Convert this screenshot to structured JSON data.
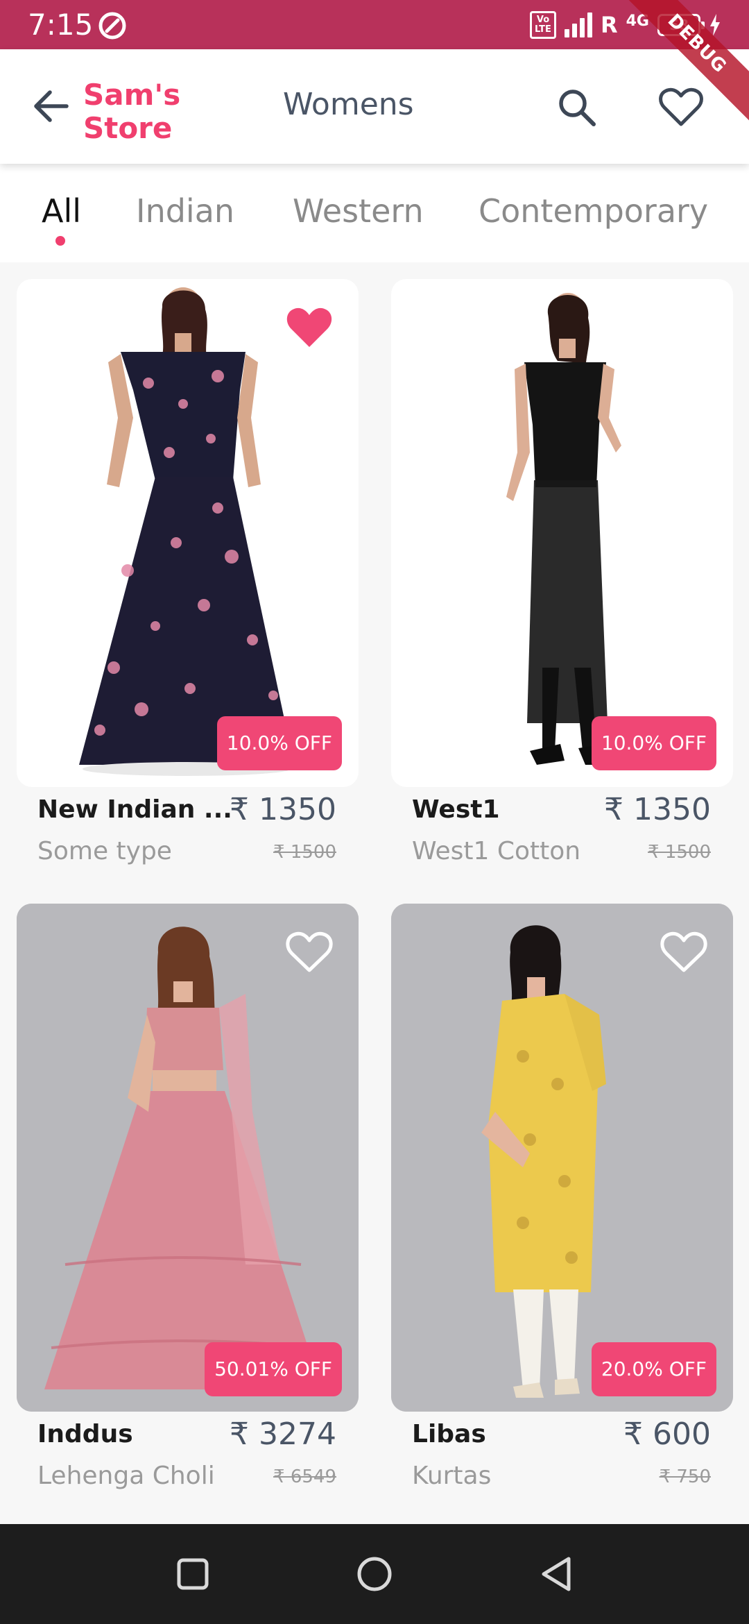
{
  "status_bar": {
    "time": "7:15",
    "volte": "Vo LTE",
    "carrier_flag": "R",
    "network": "4G",
    "battery": "58"
  },
  "debug_banner": "DEBUG",
  "app_bar": {
    "store_name": "Sam's Store",
    "title": "Womens"
  },
  "tabs": [
    {
      "label": "All",
      "active": true
    },
    {
      "label": "Indian",
      "active": false
    },
    {
      "label": "Western",
      "active": false
    },
    {
      "label": "Contemporary",
      "active": false
    }
  ],
  "products": [
    {
      "name": "New Indian ...",
      "price": "₹ 1350",
      "type": "Some type",
      "original_price": "₹ 1500",
      "discount": "10.0% OFF",
      "favorited": true
    },
    {
      "name": "West1",
      "price": "₹ 1350",
      "type": "West1 Cotton",
      "original_price": "₹ 1500",
      "discount": "10.0% OFF",
      "favorited": false
    },
    {
      "name": "Inddus",
      "price": "₹ 3274",
      "type": "Lehenga Choli",
      "original_price": "₹ 6549",
      "discount": "50.01% OFF",
      "favorited": false
    },
    {
      "name": "Libas",
      "price": "₹ 600",
      "type": "Kurtas",
      "original_price": "₹ 750",
      "discount": "20.0% OFF",
      "favorited": false
    }
  ],
  "colors": {
    "status_bar": "#b8315a",
    "accent": "#f03f6e",
    "badge": "#f04775"
  },
  "icons": {
    "back": "arrow-left-icon",
    "search": "search-icon",
    "favorites": "heart-outline-icon",
    "nav_recents": "square-icon",
    "nav_home": "circle-icon",
    "nav_back": "triangle-back-icon"
  }
}
